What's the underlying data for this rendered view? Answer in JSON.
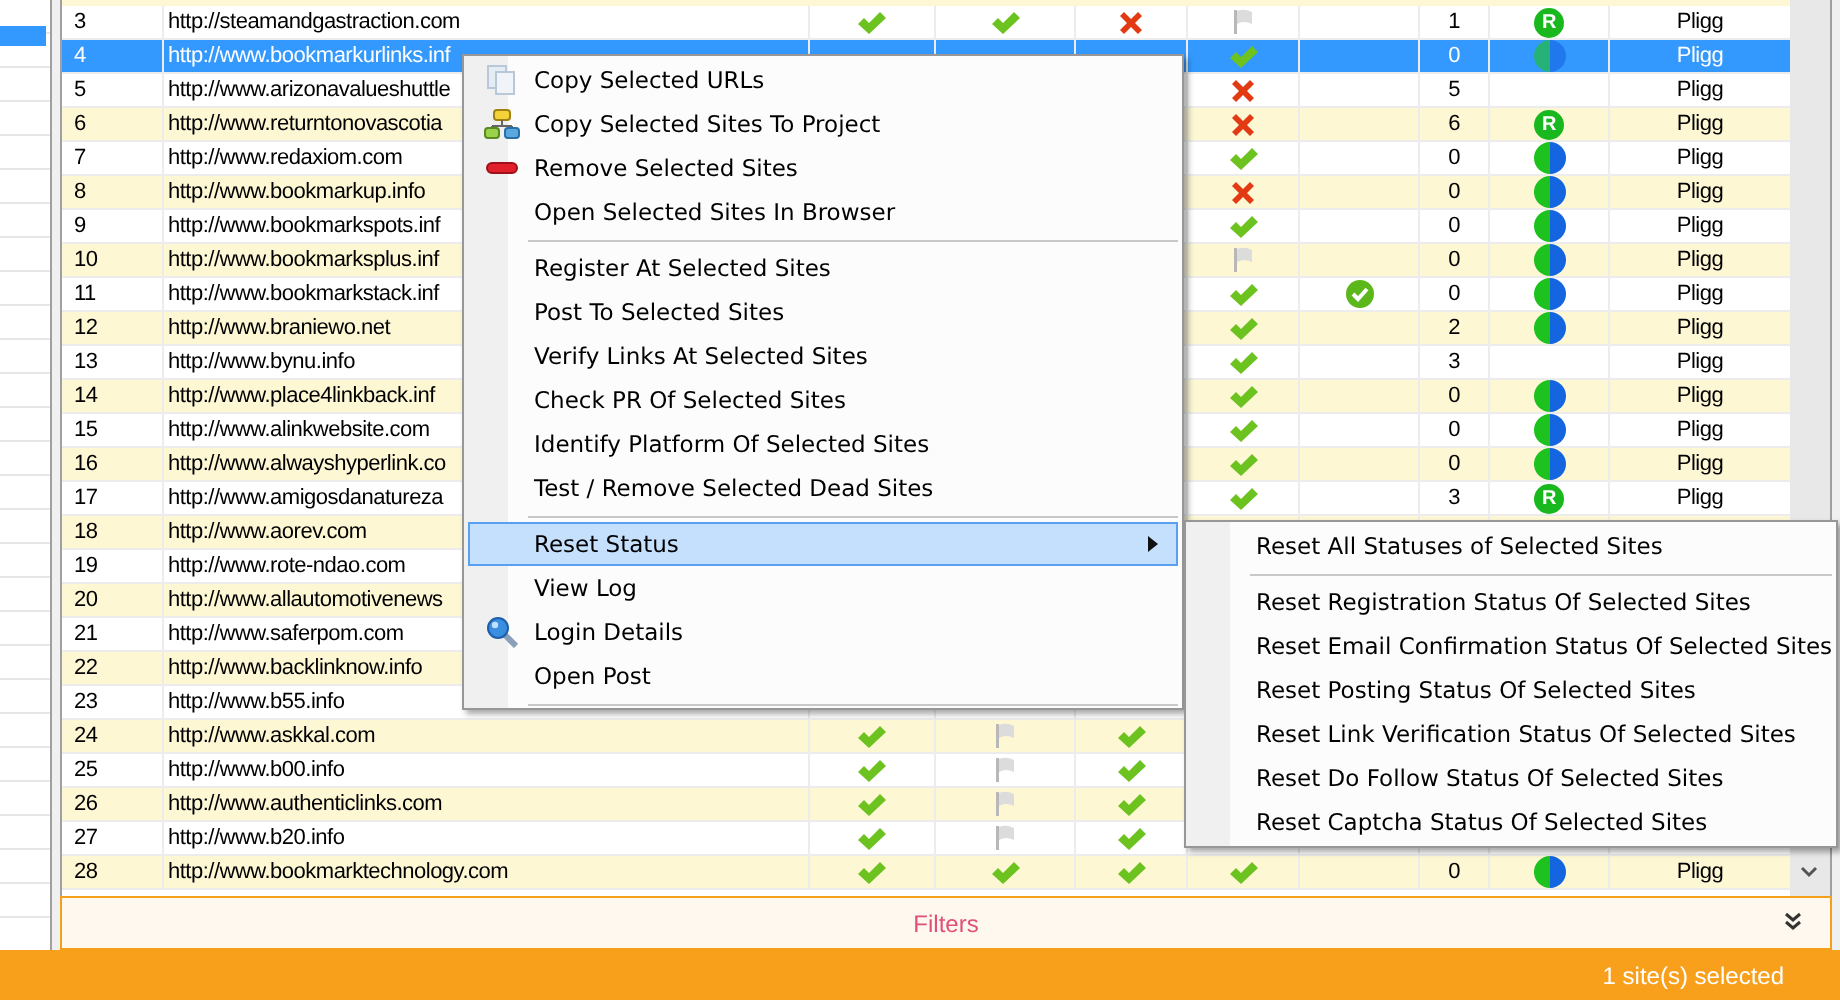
{
  "table": {
    "rows": [
      {
        "number": "3",
        "url": "http://steamandgastraction.com",
        "selected": false,
        "status_1": {
          "kind": "check"
        },
        "status_2": {
          "kind": "check"
        },
        "status_3": {
          "kind": "cross"
        },
        "status_4": {
          "kind": "flag"
        },
        "count": "1",
        "badge": {
          "kind": "letter",
          "text": "R"
        },
        "platform": "Pligg"
      },
      {
        "number": "4",
        "url": "http://www.bookmarkurlinks.inf",
        "selected": true,
        "status_4": {
          "kind": "check"
        },
        "count": "0",
        "badge": {
          "kind": "split"
        },
        "platform": "Pligg"
      },
      {
        "number": "5",
        "url": "http://www.arizonavalueshuttle",
        "selected": false,
        "status_4": {
          "kind": "cross"
        },
        "count": "5",
        "platform": "Pligg"
      },
      {
        "number": "6",
        "url": "http://www.returntonovascotia",
        "selected": false,
        "status_4": {
          "kind": "cross"
        },
        "count": "6",
        "badge": {
          "kind": "letter",
          "text": "R"
        },
        "platform": "Pligg"
      },
      {
        "number": "7",
        "url": "http://www.redaxiom.com",
        "selected": false,
        "status_4": {
          "kind": "check"
        },
        "count": "0",
        "badge": {
          "kind": "split"
        },
        "platform": "Pligg"
      },
      {
        "number": "8",
        "url": "http://www.bookmarkup.info",
        "selected": false,
        "status_4": {
          "kind": "cross"
        },
        "count": "0",
        "badge": {
          "kind": "split"
        },
        "platform": "Pligg"
      },
      {
        "number": "9",
        "url": "http://www.bookmarkspots.inf",
        "selected": false,
        "status_4": {
          "kind": "check"
        },
        "count": "0",
        "badge": {
          "kind": "split"
        },
        "platform": "Pligg"
      },
      {
        "number": "10",
        "url": "http://www.bookmarksplus.inf",
        "selected": false,
        "status_4": {
          "kind": "flag"
        },
        "count": "0",
        "badge": {
          "kind": "split"
        },
        "platform": "Pligg"
      },
      {
        "number": "11",
        "url": "http://www.bookmarkstack.inf",
        "selected": false,
        "status_4": {
          "kind": "check"
        },
        "status_5": {
          "kind": "ok"
        },
        "count": "0",
        "badge": {
          "kind": "split"
        },
        "platform": "Pligg"
      },
      {
        "number": "12",
        "url": "http://www.braniewo.net",
        "selected": false,
        "status_4": {
          "kind": "check"
        },
        "count": "2",
        "badge": {
          "kind": "split"
        },
        "platform": "Pligg"
      },
      {
        "number": "13",
        "url": "http://www.bynu.info",
        "selected": false,
        "status_4": {
          "kind": "check"
        },
        "count": "3",
        "platform": "Pligg"
      },
      {
        "number": "14",
        "url": "http://www.place4linkback.inf",
        "selected": false,
        "status_4": {
          "kind": "check"
        },
        "count": "0",
        "badge": {
          "kind": "split"
        },
        "platform": "Pligg"
      },
      {
        "number": "15",
        "url": "http://www.alinkwebsite.com",
        "selected": false,
        "status_4": {
          "kind": "check"
        },
        "count": "0",
        "badge": {
          "kind": "split"
        },
        "platform": "Pligg"
      },
      {
        "number": "16",
        "url": "http://www.alwayshyperlink.co",
        "selected": false,
        "status_4": {
          "kind": "check"
        },
        "count": "0",
        "badge": {
          "kind": "split"
        },
        "platform": "Pligg"
      },
      {
        "number": "17",
        "url": "http://www.amigosdanatureza",
        "selected": false,
        "status_4": {
          "kind": "check"
        },
        "count": "3",
        "badge": {
          "kind": "letter",
          "text": "R"
        },
        "platform": "Pligg"
      },
      {
        "number": "18",
        "url": "http://www.aorev.com",
        "selected": false
      },
      {
        "number": "19",
        "url": "http://www.rote-ndao.com",
        "selected": false
      },
      {
        "number": "20",
        "url": "http://www.allautomotivenews",
        "selected": false
      },
      {
        "number": "21",
        "url": "http://www.saferpom.com",
        "selected": false
      },
      {
        "number": "22",
        "url": "http://www.backlinknow.info",
        "selected": false
      },
      {
        "number": "23",
        "url": "http://www.b55.info",
        "selected": false
      },
      {
        "number": "24",
        "url": "http://www.askkal.com",
        "selected": false,
        "status_1": {
          "kind": "check"
        },
        "status_2": {
          "kind": "flag"
        },
        "status_3": {
          "kind": "check"
        }
      },
      {
        "number": "25",
        "url": "http://www.b00.info",
        "selected": false,
        "status_1": {
          "kind": "check"
        },
        "status_2": {
          "kind": "flag"
        },
        "status_3": {
          "kind": "check"
        }
      },
      {
        "number": "26",
        "url": "http://www.authenticlinks.com",
        "selected": false,
        "status_1": {
          "kind": "check"
        },
        "status_2": {
          "kind": "flag"
        },
        "status_3": {
          "kind": "check"
        }
      },
      {
        "number": "27",
        "url": "http://www.b20.info",
        "selected": false,
        "status_1": {
          "kind": "check"
        },
        "status_2": {
          "kind": "flag"
        },
        "status_3": {
          "kind": "check"
        }
      },
      {
        "number": "28",
        "url": "http://www.bookmarktechnology.com",
        "selected": false,
        "status_1": {
          "kind": "check"
        },
        "status_2": {
          "kind": "check"
        },
        "status_3": {
          "kind": "check"
        },
        "status_4": {
          "kind": "check"
        },
        "count": "0",
        "badge": {
          "kind": "split"
        },
        "platform": "Pligg"
      }
    ]
  },
  "context_menu": {
    "items": [
      {
        "kind": "item",
        "label": "Copy Selected URLs",
        "selected": false
      },
      {
        "kind": "item",
        "label": "Copy Selected Sites To Project",
        "selected": false
      },
      {
        "kind": "item",
        "label": "Remove Selected Sites",
        "selected": false
      },
      {
        "kind": "item",
        "label": "Open Selected Sites In Browser",
        "selected": false
      },
      {
        "kind": "separator"
      },
      {
        "kind": "item",
        "label": "Register At Selected Sites",
        "selected": false
      },
      {
        "kind": "item",
        "label": "Post To Selected Sites",
        "selected": false
      },
      {
        "kind": "item",
        "label": "Verify Links At Selected Sites",
        "selected": false
      },
      {
        "kind": "item",
        "label": "Check PR Of Selected Sites",
        "selected": false
      },
      {
        "kind": "item",
        "label": "Identify Platform Of Selected Sites",
        "selected": false
      },
      {
        "kind": "item",
        "label": "Test / Remove Selected Dead Sites",
        "selected": false
      },
      {
        "kind": "separator"
      },
      {
        "kind": "submenu",
        "label": "Reset Status",
        "selected": true
      },
      {
        "kind": "item",
        "label": "View Log",
        "selected": false
      },
      {
        "kind": "item",
        "label": "Login Details",
        "selected": false
      },
      {
        "kind": "item",
        "label": "Open Post",
        "selected": false
      },
      {
        "kind": "separator"
      }
    ]
  },
  "submenu": {
    "items": [
      {
        "kind": "item",
        "label": "Reset All Statuses of Selected Sites"
      },
      {
        "kind": "separator"
      },
      {
        "kind": "item",
        "label": "Reset Registration Status Of Selected Sites"
      },
      {
        "kind": "item",
        "label": "Reset Email Confirmation Status Of Selected Sites"
      },
      {
        "kind": "item",
        "label": "Reset Posting Status Of Selected Sites"
      },
      {
        "kind": "item",
        "label": "Reset Link Verification Status Of Selected Sites"
      },
      {
        "kind": "item",
        "label": "Reset Do Follow Status Of Selected Sites"
      },
      {
        "kind": "item",
        "label": "Reset Captcha Status Of Selected Sites"
      }
    ]
  },
  "filters": {
    "label": "Filters"
  },
  "status_bar": {
    "text": "1 site(s) selected"
  }
}
